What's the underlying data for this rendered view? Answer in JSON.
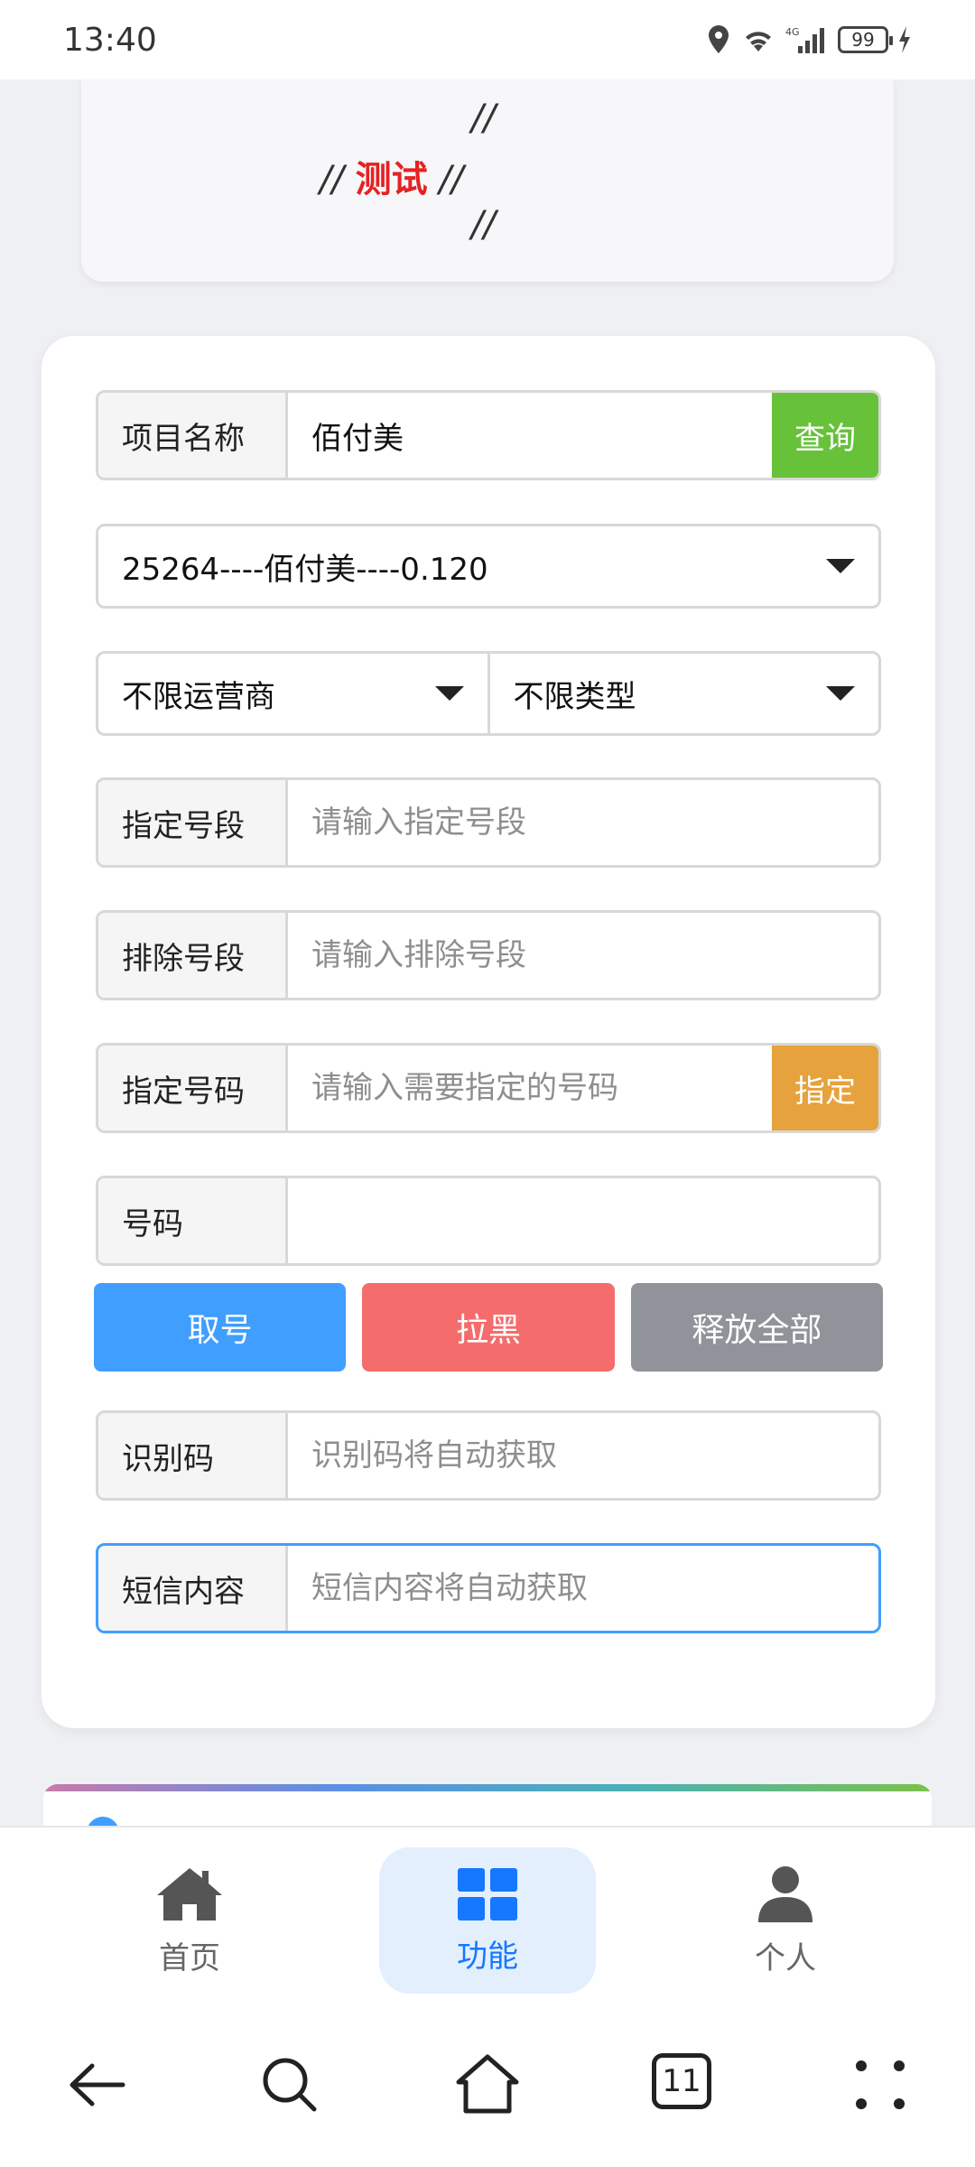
{
  "status_bar": {
    "time": "13:40",
    "battery": "99",
    "network": "4G"
  },
  "notice": {
    "slashes": "//",
    "highlight": "测试"
  },
  "form": {
    "project": {
      "label": "项目名称",
      "value": "佰付美",
      "button": "查询"
    },
    "project_select": {
      "value": "25264----佰付美----0.120"
    },
    "operator_select": {
      "value": "不限运营商"
    },
    "type_select": {
      "value": "不限类型"
    },
    "segment": {
      "label": "指定号段",
      "placeholder": "请输入指定号段"
    },
    "exclude_segment": {
      "label": "排除号段",
      "placeholder": "请输入排除号段"
    },
    "specify_number": {
      "label": "指定号码",
      "placeholder": "请输入需要指定的号码",
      "button": "指定"
    },
    "number": {
      "label": "号码",
      "value": ""
    },
    "actions": {
      "get": "取号",
      "blacklist": "拉黑",
      "release_all": "释放全部"
    },
    "code": {
      "label": "识别码",
      "placeholder": "识别码将自动获取"
    },
    "sms": {
      "label": "短信内容",
      "placeholder": "短信内容将自动获取"
    }
  },
  "app_nav": {
    "items": [
      {
        "label": "首页",
        "icon": "home-icon"
      },
      {
        "label": "功能",
        "icon": "grid-icon",
        "active": true
      },
      {
        "label": "个人",
        "icon": "person-icon"
      }
    ]
  },
  "system_nav": {
    "tabs_count": "11"
  },
  "colors": {
    "green": "#67c23a",
    "orange": "#e6a23c",
    "blue": "#409eff",
    "red": "#f56c6c",
    "gray": "#909399",
    "nav_active": "#1677ff"
  }
}
